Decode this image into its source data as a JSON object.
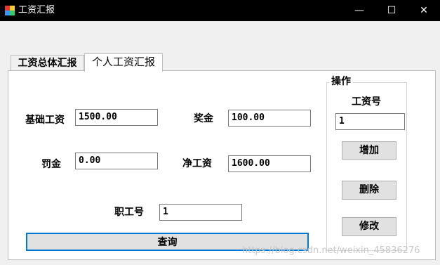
{
  "window": {
    "title": "工资汇报",
    "controls": {
      "minimize": "—",
      "maximize": "☐",
      "close": "✕"
    }
  },
  "tabs": [
    {
      "label": "工资总体汇报",
      "active": false
    },
    {
      "label": "个人工资汇报",
      "active": true
    }
  ],
  "form": {
    "basic_salary": {
      "label": "基础工资",
      "value": "1500.00"
    },
    "bonus": {
      "label": "奖金",
      "value": "100.00"
    },
    "penalty": {
      "label": "罚金",
      "value": "0.00"
    },
    "net_salary": {
      "label": "净工资",
      "value": "1600.00"
    },
    "employee_id": {
      "label": "职工号",
      "value": "1"
    },
    "query_button": "查询"
  },
  "operations": {
    "title": "操作",
    "salary_no_label": "工资号",
    "salary_no_value": "1",
    "add_button": "增加",
    "delete_button": "删除",
    "modify_button": "修改"
  },
  "watermark": "https://blog.csdn.net/weixin_45836276"
}
